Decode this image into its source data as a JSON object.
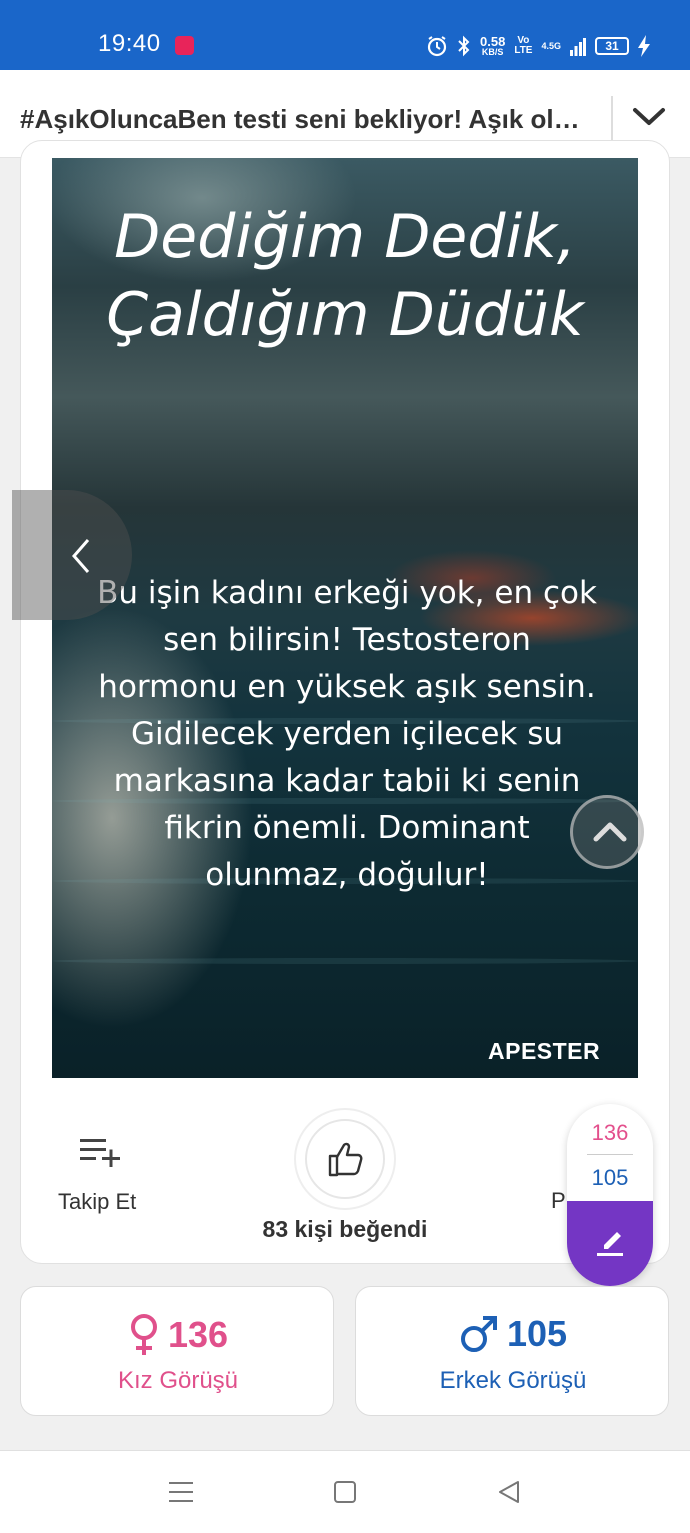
{
  "status_bar": {
    "time": "19:40",
    "speed_value": "0.58",
    "speed_unit": "KB/S",
    "volte_top": "Vo",
    "volte_bottom": "LTE",
    "network": "4.5G",
    "battery": "31",
    "icons": [
      "app-notification-icon",
      "alarm-icon",
      "bluetooth-icon",
      "signal-icon",
      "charging-icon"
    ]
  },
  "header": {
    "title": "#AşıkOluncaBen testi seni bekliyor! Aşık olunca nasıl birisin?",
    "expand_icon": "chevron-down-icon"
  },
  "media": {
    "title": "Dediğim Dedik, Çaldığım Düdük",
    "body": "Bu işin kadını erkeği yok, en çok sen bilirsin! Testosteron hormonu en yüksek aşık sensin. Gidilecek yerden içilecek su markasına kadar tabii ki senin fikrin önemli. Dominant olunmaz, doğulur!",
    "watermark": "APESTER"
  },
  "actions": {
    "follow_label": "Takip Et",
    "like_count": "83 kişi beğendi",
    "share_label_partial": "P"
  },
  "opinion_widget": {
    "girls_count": "136",
    "boys_count": "105"
  },
  "gender_cards": {
    "girl": {
      "count": "136",
      "label": "Kız Görüşü"
    },
    "boy": {
      "count": "105",
      "label": "Erkek Görüşü"
    }
  },
  "colors": {
    "status_bar": "#1a66c9",
    "girl": "#e0508b",
    "boy": "#1d60b5",
    "write_button": "#7436c4"
  }
}
